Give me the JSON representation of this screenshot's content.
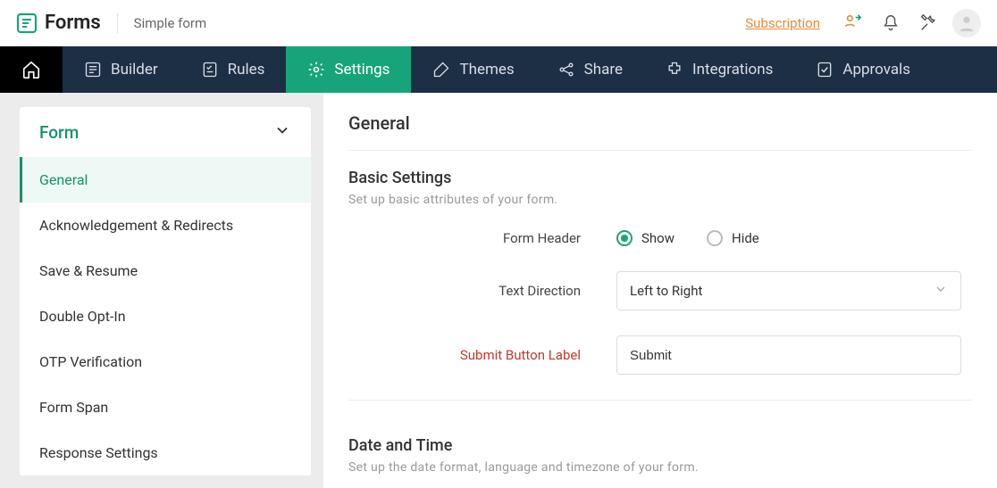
{
  "brand": {
    "name": "Forms"
  },
  "breadcrumb": {
    "form_name": "Simple form"
  },
  "topbar": {
    "subscription_label": "Subscription"
  },
  "nav": {
    "items": [
      {
        "label": "Builder",
        "icon": "builder-icon",
        "active": false
      },
      {
        "label": "Rules",
        "icon": "rules-icon",
        "active": false
      },
      {
        "label": "Settings",
        "icon": "settings-icon",
        "active": true
      },
      {
        "label": "Themes",
        "icon": "themes-icon",
        "active": false
      },
      {
        "label": "Share",
        "icon": "share-icon",
        "active": false
      },
      {
        "label": "Integrations",
        "icon": "integrations-icon",
        "active": false
      },
      {
        "label": "Approvals",
        "icon": "approvals-icon",
        "active": false
      }
    ]
  },
  "sidebar": {
    "header": "Form",
    "items": [
      {
        "label": "General",
        "active": true
      },
      {
        "label": "Acknowledgement & Redirects",
        "active": false
      },
      {
        "label": "Save & Resume",
        "active": false
      },
      {
        "label": "Double Opt-In",
        "active": false
      },
      {
        "label": "OTP Verification",
        "active": false
      },
      {
        "label": "Form Span",
        "active": false
      },
      {
        "label": "Response Settings",
        "active": false
      }
    ]
  },
  "page": {
    "title": "General",
    "sections": {
      "basic": {
        "title": "Basic Settings",
        "subtitle": "Set up basic attributes of your form.",
        "form_header_label": "Form Header",
        "form_header_options": {
          "show": "Show",
          "hide": "Hide"
        },
        "form_header_value": "show",
        "text_direction_label": "Text Direction",
        "text_direction_value": "Left to Right",
        "submit_button_label_label": "Submit Button Label",
        "submit_button_label_value": "Submit"
      },
      "datetime": {
        "title": "Date and Time",
        "subtitle": "Set up the date format, language and timezone of your form."
      }
    }
  }
}
